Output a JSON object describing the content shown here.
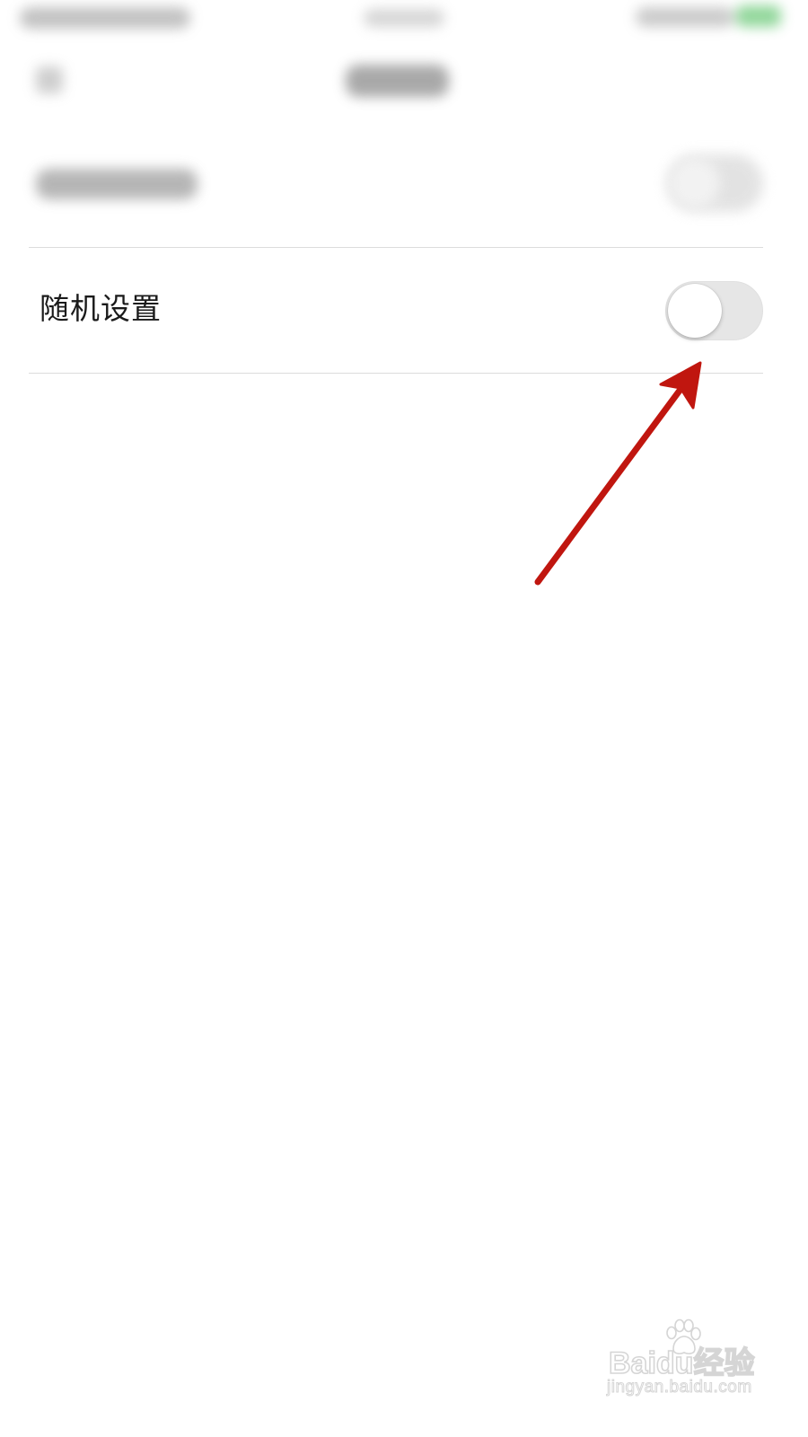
{
  "settings": {
    "items": [
      {
        "label": "随机设置",
        "toggle_on": false
      }
    ]
  },
  "colors": {
    "toggle_track_off": "#e6e6e6",
    "toggle_knob": "#ffffff",
    "divider": "#dcdcdc",
    "annotation_arrow": "#c0160f",
    "status_battery": "#7fd08a"
  },
  "icons": {
    "watermark_logo": "baidu-paw-icon"
  },
  "watermark": {
    "brand": "Baidu经验",
    "url": "jingyan.baidu.com"
  }
}
